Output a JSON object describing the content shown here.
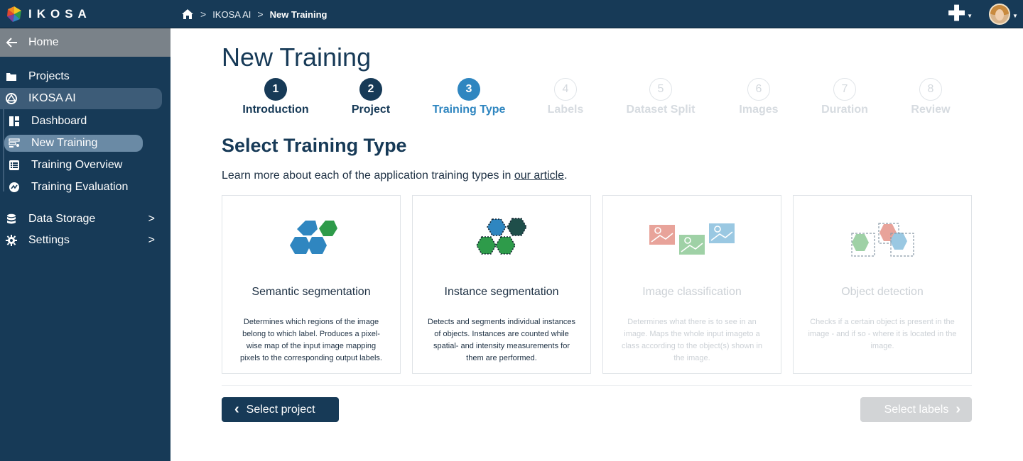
{
  "topbar": {
    "logo_text": "IKOSA",
    "breadcrumbs": [
      "IKOSA AI",
      "New Training"
    ],
    "plus_icon": "plus-icon",
    "avatar_icon": "user-avatar"
  },
  "sidebar": {
    "home_label": "Home",
    "items": [
      {
        "label": "Projects",
        "icon": "folder-icon"
      },
      {
        "label": "IKOSA AI",
        "icon": "ai-icon"
      },
      {
        "label": "Dashboard",
        "icon": "dashboard-icon"
      },
      {
        "label": "New Training",
        "icon": "training-icon"
      },
      {
        "label": "Training Overview",
        "icon": "list-icon"
      },
      {
        "label": "Training Evaluation",
        "icon": "evaluation-icon"
      },
      {
        "label": "Data Storage",
        "icon": "database-icon"
      },
      {
        "label": "Settings",
        "icon": "gear-icon"
      }
    ]
  },
  "main": {
    "title": "New Training",
    "steps": [
      {
        "num": "1",
        "label": "Introduction",
        "state": "done"
      },
      {
        "num": "2",
        "label": "Project",
        "state": "done"
      },
      {
        "num": "3",
        "label": "Training Type",
        "state": "current"
      },
      {
        "num": "4",
        "label": "Labels",
        "state": "future"
      },
      {
        "num": "5",
        "label": "Dataset Split",
        "state": "future"
      },
      {
        "num": "6",
        "label": "Images",
        "state": "future"
      },
      {
        "num": "7",
        "label": "Duration",
        "state": "future"
      },
      {
        "num": "8",
        "label": "Review",
        "state": "future"
      }
    ],
    "section_title": "Select Training Type",
    "intro_text": "Learn more about each of the application training types in ",
    "intro_link": "our article",
    "intro_end": ".",
    "cards": [
      {
        "title": "Semantic segmentation",
        "desc": "Determines which regions of the image belong to which label. Produces a pixel-wise map of the input image mapping pixels to the corresponding output labels.",
        "enabled": true
      },
      {
        "title": "Instance segmentation",
        "desc": "Detects and segments individual instances of objects. Instances are counted while spatial- and intensity measurements for them are performed.",
        "enabled": true
      },
      {
        "title": "Image classification",
        "desc": "Determines what there is to see in an image. Maps the whole input imageto a class according to the object(s) shown in the image.",
        "enabled": false
      },
      {
        "title": "Object detection",
        "desc": "Checks if a certain object is present in the image - and if so - where it is located in the image.",
        "enabled": false
      }
    ],
    "back_button": "Select project",
    "next_button": "Select labels"
  },
  "colors": {
    "navy": "#173a57",
    "accent_blue": "#2f86c0",
    "green": "#2e9b4a",
    "disabled": "#d2d4d6"
  }
}
